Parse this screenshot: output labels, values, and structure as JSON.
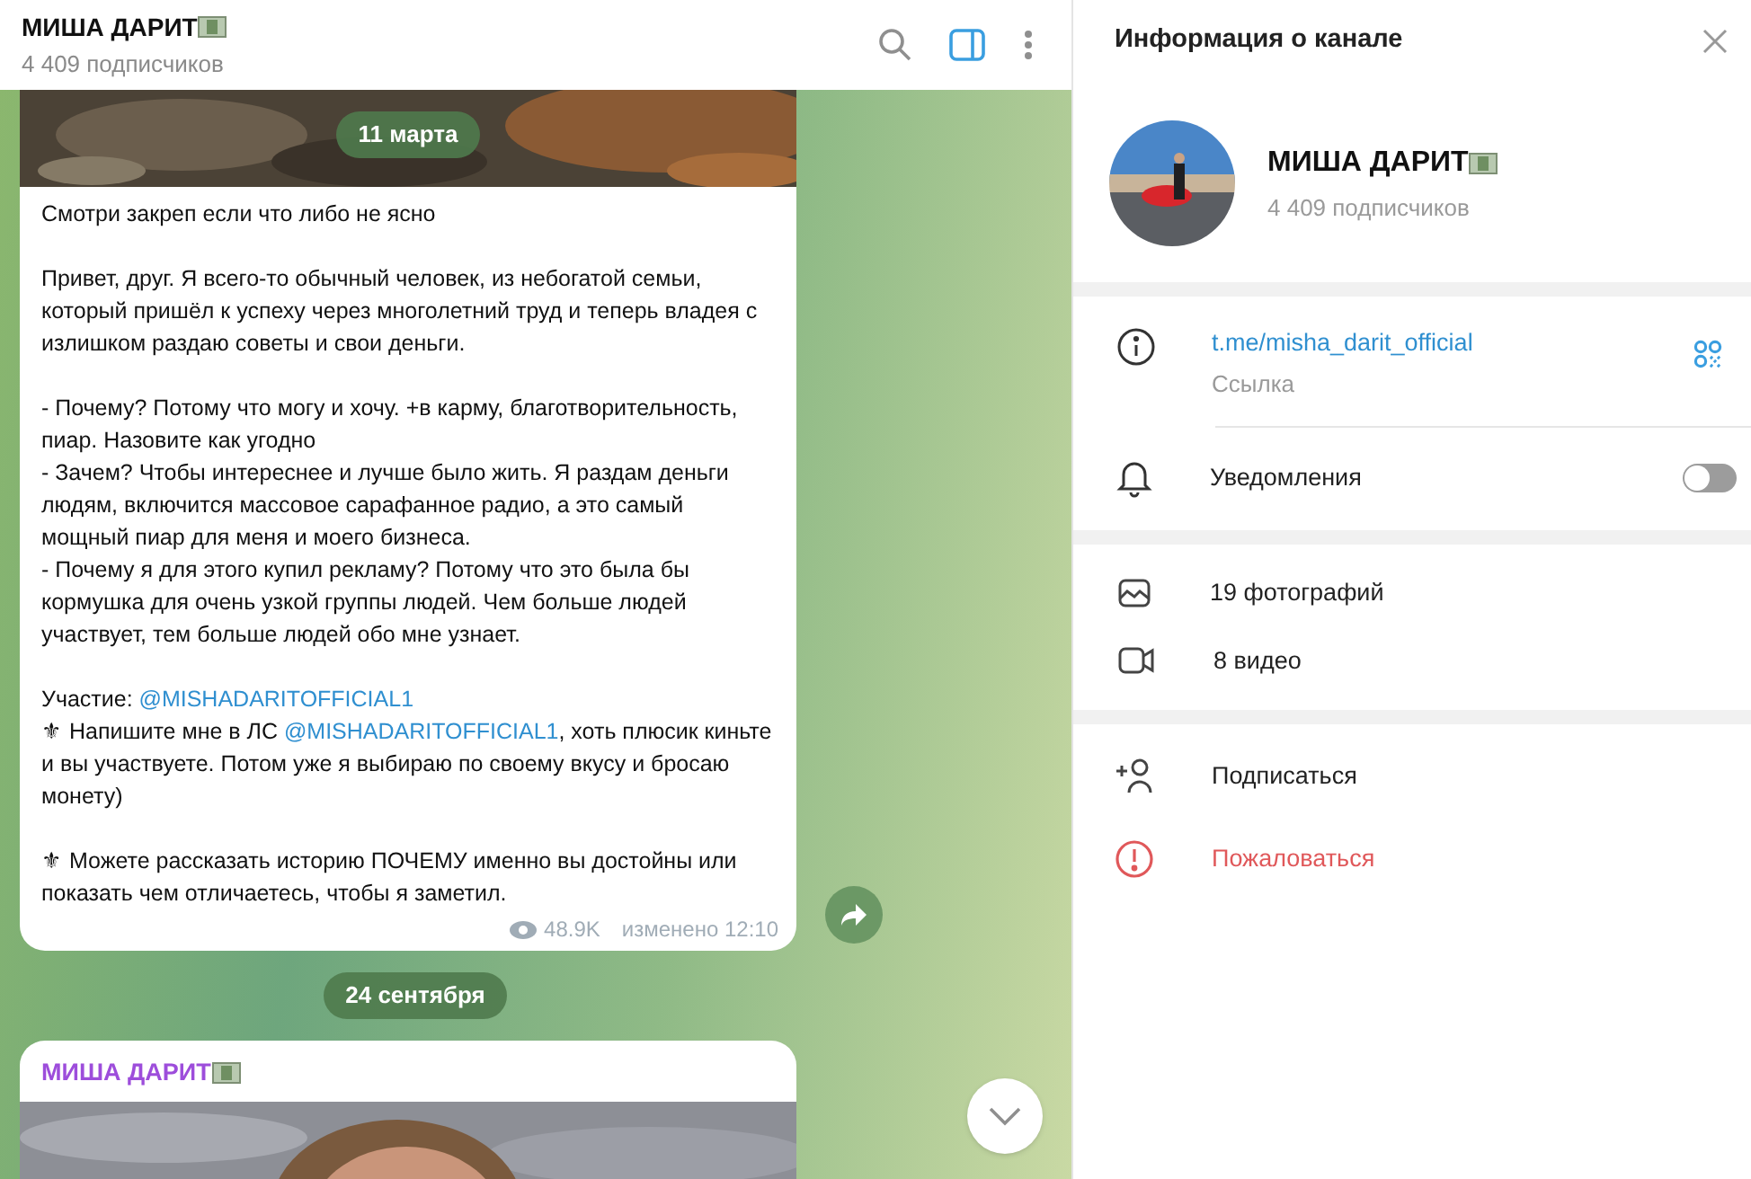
{
  "header": {
    "title": "МИША ДАРИТ",
    "subtitle": "4 409 подписчиков",
    "side_panel_open": true
  },
  "feed": [
    {
      "kind": "post",
      "date": "11 марта",
      "paragraphs": [
        [
          {
            "kind": "text",
            "text": "Смотри закреп если что либо не ясно"
          }
        ],
        [
          {
            "kind": "text",
            "text": "Привет, друг. Я всего-то обычный человек, из небогатой семьи, который пришёл к успеху через многолетний труд и теперь владея с излишком раздаю советы и свои деньги."
          }
        ],
        [
          {
            "kind": "text",
            "text": "- Почему? Потому что могу и хочу. +в карму, благотворительность, пиар. Назовите как угодно"
          },
          {
            "kind": "break"
          },
          {
            "kind": "text",
            "text": "- Зачем? Чтобы интереснее и лучше было жить. Я раздам деньги людям, включится массовое сарафанное радио, а это самый мощный пиар для меня и моего бизнеса."
          },
          {
            "kind": "break"
          },
          {
            "kind": "text",
            "text": "- Почему я для этого купил рекламу? Потому что это была бы кормушка для очень узкой группы людей. Чем больше людей участвует, тем больше людей обо мне узнает."
          }
        ],
        [
          {
            "kind": "text",
            "text": "Участие: "
          },
          {
            "kind": "mention",
            "text": "@MISHADARITOFFICIAL1"
          },
          {
            "kind": "break"
          },
          {
            "kind": "text",
            "text": "⚜ Напишите мне в ЛС "
          },
          {
            "kind": "mention",
            "text": "@MISHADARITOFFICIAL1"
          },
          {
            "kind": "text",
            "text": ", хоть плюсик киньте и вы участвуете. Потом уже я выбираю по своему вкусу и бросаю монету)"
          }
        ],
        [
          {
            "kind": "text",
            "text": "⚜ Можете рассказать историю ПОЧЕМУ именно вы достойны или показать чем отличаетесь, чтобы я заметил."
          }
        ]
      ],
      "views": "48.9K",
      "edited": "изменено 12:10"
    },
    {
      "kind": "post_start",
      "date": "24 сентября",
      "author": "МИША ДАРИТ"
    }
  ],
  "info_panel": {
    "title": "Информация о канале",
    "name": "МИША ДАРИТ",
    "subscribers": "4 409 подписчиков",
    "link": "t.me/misha_darit_official",
    "link_label": "Ссылка",
    "notifications_label": "Уведомления",
    "notifications_on": false,
    "media": [
      {
        "label": "19 фотографий"
      },
      {
        "kind": "video",
        "label": "8 видео"
      }
    ],
    "actions": [
      {
        "kind": "subscribe",
        "label": "Подписаться"
      },
      {
        "kind": "report",
        "label": "Пожаловаться"
      }
    ]
  }
}
